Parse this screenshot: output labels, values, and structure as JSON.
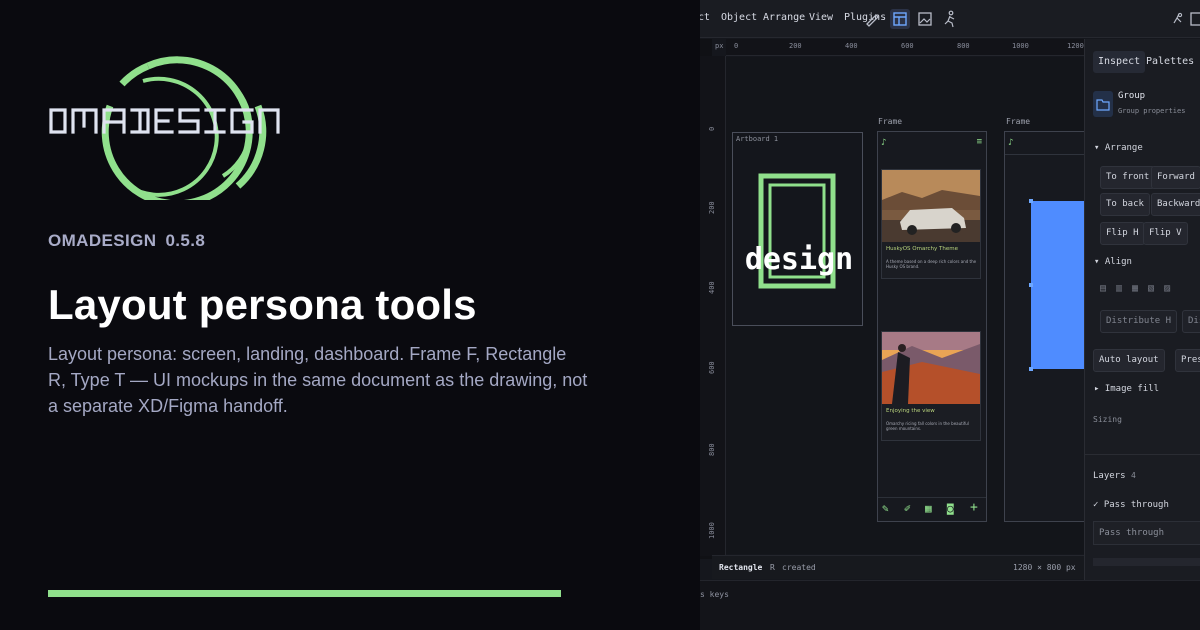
{
  "promo": {
    "logo_text": "OMADESIGN",
    "product_name": "OMADESIGN",
    "version": "0.5.8",
    "headline": "Layout persona tools",
    "description": "Layout persona: screen, landing, dashboard. Frame F, Rectangle R, Type T — UI mockups in the same document as the drawing, not a separate XD/Figma handoff.",
    "accent_color": "#90e08c"
  },
  "app": {
    "menu": [
      "ct",
      "Object",
      "Arrange",
      "View",
      "Plugins"
    ],
    "tools": [
      "pen-icon",
      "brush-icon",
      "layout-icon",
      "image-icon",
      "figure-icon",
      "plugin-icon",
      "picture-icon"
    ],
    "ruler_top": [
      "px",
      "0",
      "200",
      "400",
      "600",
      "800",
      "1000",
      "1200"
    ],
    "ruler_left": [
      "0",
      "200",
      "400",
      "600",
      "800",
      "1000"
    ],
    "canvas": {
      "artboard_label": "Artboard 1",
      "artboard_logo_text": "design",
      "frame_label_1": "Frame",
      "frame_label_2": "Frame",
      "card1_title": "HuskyOS Omarchy Theme",
      "card1_desc": "A theme based on a deep rich colors and the Husky OS brand.",
      "card2_title": "Enjoying the view",
      "card2_desc": "Omarchy ricing fall colors in the beautiful green mountains.",
      "shape_color": "#4f8cff"
    },
    "status": {
      "tool": "Rectangle",
      "shortcut": "R",
      "action": "created",
      "size": "1280 × 800 px",
      "keys": "s keys"
    },
    "inspector": {
      "tabs": [
        "Inspect",
        "Palettes",
        "L"
      ],
      "group_title": "Group",
      "group_sub": "Group properties",
      "arrange_label": "Arrange",
      "arrange_buttons": [
        "To front",
        "Forward",
        "To back",
        "Backward",
        "Flip H",
        "Flip V"
      ],
      "align_label": "Align",
      "distribute_buttons": [
        "Distribute H",
        "Distr"
      ],
      "layout_buttons": [
        "Auto layout",
        "Present"
      ],
      "image_fill_label": "Image fill",
      "sizing_label": "Sizing",
      "layers_label": "Layers",
      "layers_count": "4",
      "pass_through_label": "Pass through",
      "pass_through_select": "Pass through"
    }
  }
}
